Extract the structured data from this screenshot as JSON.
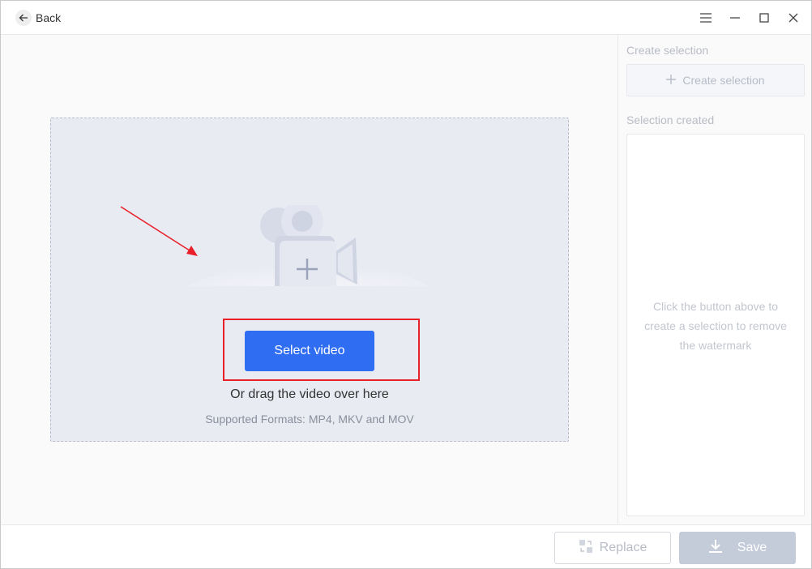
{
  "titlebar": {
    "back_label": "Back"
  },
  "dropzone": {
    "select_button_label": "Select video",
    "drag_text": "Or drag the video over here",
    "formats_text": "Supported Formats: MP4, MKV and MOV"
  },
  "side": {
    "create_heading": "Create selection",
    "create_button_label": "Create selection",
    "created_heading": "Selection created",
    "hint": "Click the button above to create a selection to remove the watermark"
  },
  "bottom": {
    "replace_label": "Replace",
    "save_label": "Save"
  },
  "colors": {
    "accent": "#2f6df3",
    "highlight": "#e8202a",
    "disabled": "#c4cbd9"
  }
}
